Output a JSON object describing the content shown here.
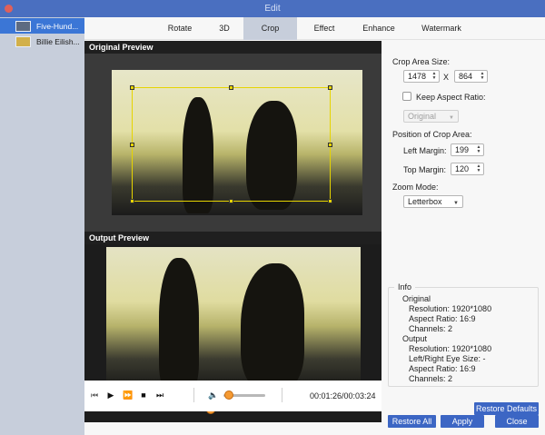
{
  "window": {
    "title": "Edit"
  },
  "sidebar": {
    "items": [
      {
        "label": "Five-Hund...",
        "selected": true
      },
      {
        "label": "Billie Eilish...",
        "selected": false
      }
    ]
  },
  "tabs": [
    {
      "label": "Rotate",
      "active": false
    },
    {
      "label": "3D",
      "active": false
    },
    {
      "label": "Crop",
      "active": true
    },
    {
      "label": "Effect",
      "active": false
    },
    {
      "label": "Enhance",
      "active": false
    },
    {
      "label": "Watermark",
      "active": false
    }
  ],
  "preview": {
    "original_header": "Original Preview",
    "output_header": "Output Preview",
    "seek_position": 0.42,
    "volume_level": 0.12,
    "time": "00:01:26/00:03:24"
  },
  "crop": {
    "size_label": "Crop Area Size:",
    "width": "1478",
    "times": "X",
    "height": "864",
    "keep_aspect_label": "Keep Aspect Ratio:",
    "keep_aspect_checked": false,
    "aspect_value": "Original",
    "position_label": "Position of Crop Area:",
    "left_margin_label": "Left Margin:",
    "left_margin": "199",
    "top_margin_label": "Top Margin:",
    "top_margin": "120",
    "zoom_label": "Zoom Mode:",
    "zoom_value": "Letterbox"
  },
  "info": {
    "legend": "Info",
    "original_heading": "Original",
    "orig_resolution": "Resolution: 1920*1080",
    "orig_aspect": "Aspect Ratio: 16:9",
    "orig_channels": "Channels: 2",
    "output_heading": "Output",
    "out_resolution": "Resolution: 1920*1080",
    "out_eye": "Left/Right Eye Size: -",
    "out_aspect": "Aspect Ratio: 16:9",
    "out_channels": "Channels: 2"
  },
  "buttons": {
    "restore_defaults": "Restore Defaults",
    "restore_all": "Restore All",
    "apply": "Apply",
    "close": "Close"
  },
  "colors": {
    "titlebar": "#4a6fc0",
    "accent_button": "#3c66c4",
    "slider_thumb": "#f59a33",
    "crop_border": "#e6d400"
  }
}
